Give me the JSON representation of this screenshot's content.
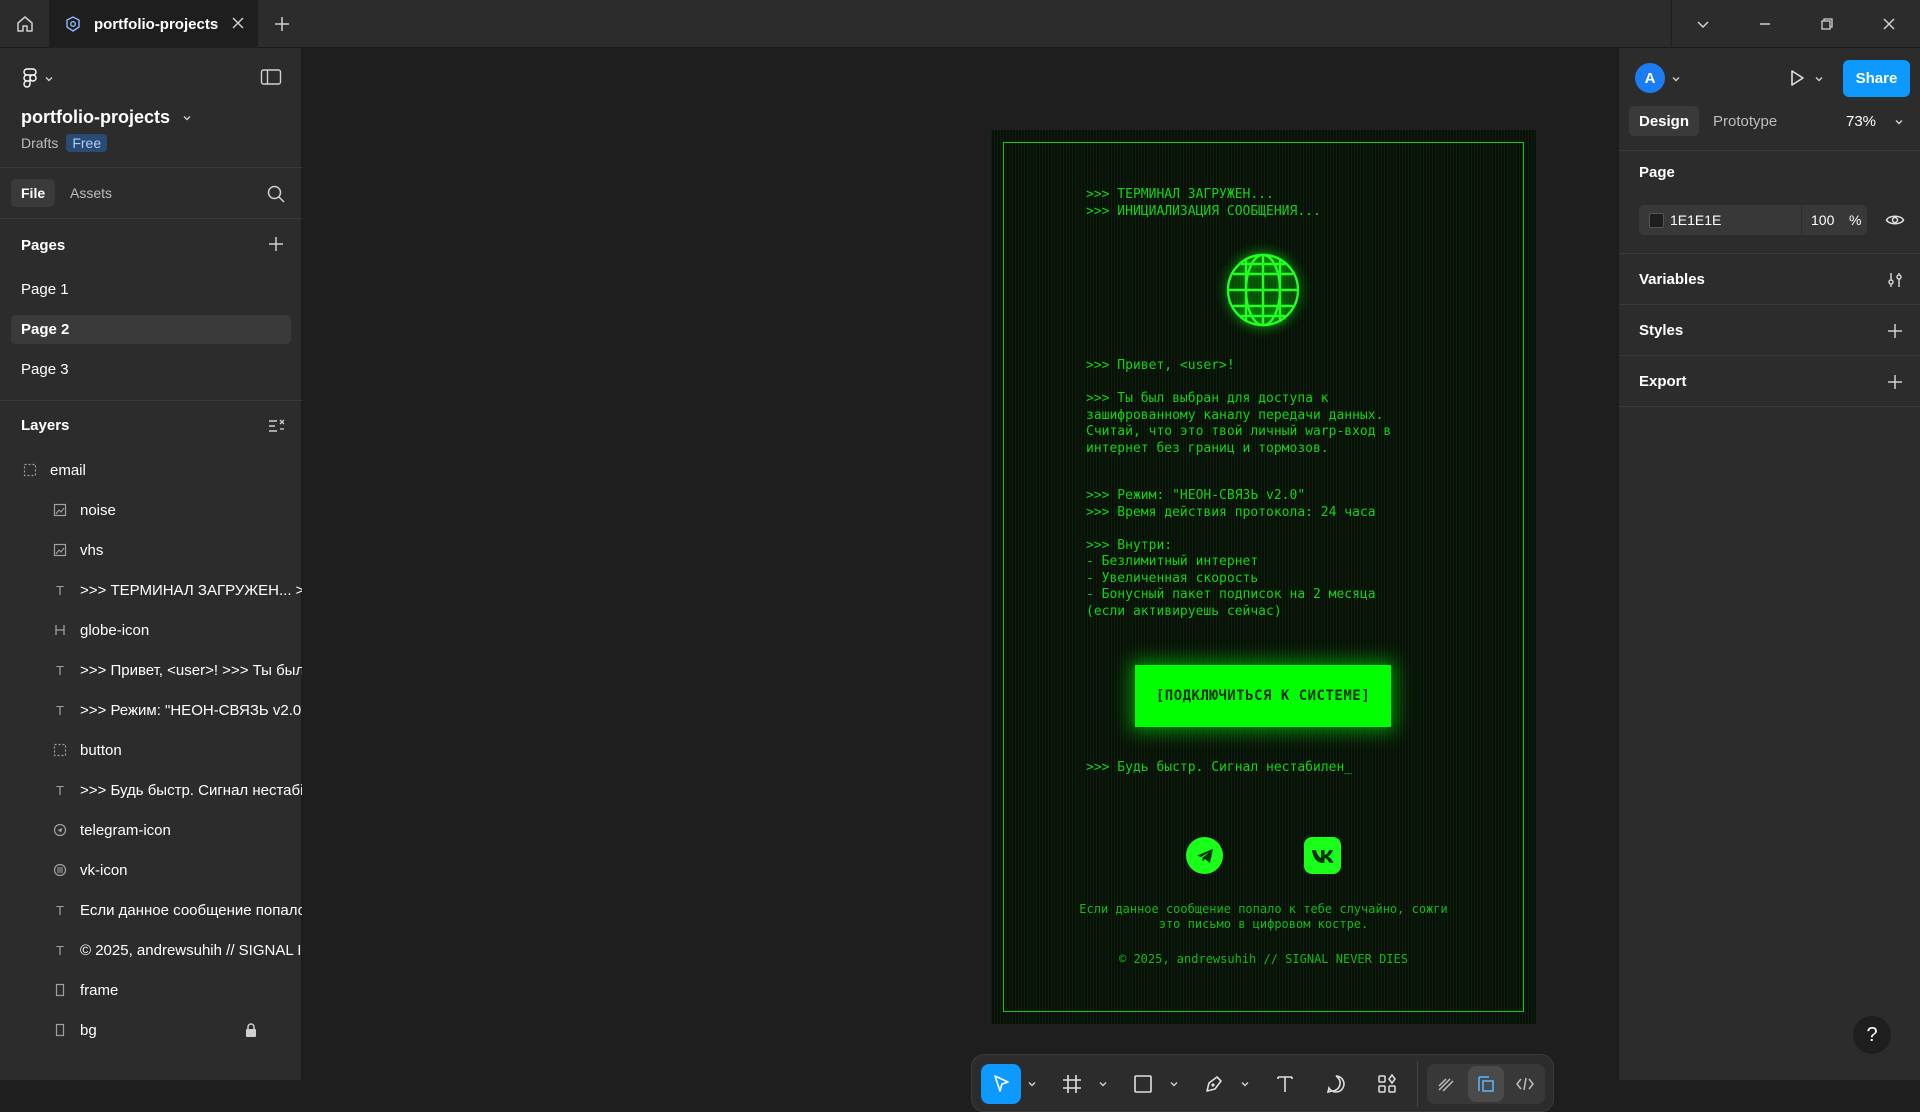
{
  "titlebar": {
    "tab_label": "portfolio-projects"
  },
  "file": {
    "project_name": "portfolio-projects",
    "location": "Drafts",
    "plan_badge": "Free"
  },
  "left_tabs": {
    "file": "File",
    "assets": "Assets"
  },
  "pages": {
    "header": "Pages",
    "items": [
      {
        "label": "Page 1",
        "active": false
      },
      {
        "label": "Page 2",
        "active": true
      },
      {
        "label": "Page 3",
        "active": false
      }
    ]
  },
  "layers": {
    "header": "Layers",
    "items": [
      {
        "label": "email",
        "icon": "frame-dashed-icon",
        "level": "root"
      },
      {
        "label": "noise",
        "icon": "image-icon",
        "level": "child"
      },
      {
        "label": "vhs",
        "icon": "image-icon",
        "level": "child"
      },
      {
        "label": ">>> ТЕРМИНАЛ ЗАГРУЖЕН... >>",
        "icon": "text-icon",
        "level": "child"
      },
      {
        "label": "globe-icon",
        "icon": "vector-icon",
        "level": "child"
      },
      {
        "label": ">>> Привет, <user>! >>> Ты был",
        "icon": "text-icon",
        "level": "child"
      },
      {
        "label": ">>> Режим: \"НЕОН-СВЯЗЬ v2.0\"",
        "icon": "text-icon",
        "level": "child"
      },
      {
        "label": "button",
        "icon": "frame-dashed-icon",
        "level": "child"
      },
      {
        "label": ">>> Будь быстр. Сигнал нестабі",
        "icon": "text-icon",
        "level": "child"
      },
      {
        "label": "telegram-icon",
        "icon": "component-icon",
        "level": "child"
      },
      {
        "label": "vk-icon",
        "icon": "component-icon",
        "level": "child"
      },
      {
        "label": "Если данное сообщение попало",
        "icon": "text-icon",
        "level": "child"
      },
      {
        "label": "© 2025, andrewsuhih // SIGNAL I",
        "icon": "text-icon",
        "level": "child"
      },
      {
        "label": "frame",
        "icon": "rectangle-icon",
        "level": "child"
      },
      {
        "label": "bg",
        "icon": "rectangle-icon",
        "level": "child",
        "locked": true
      }
    ]
  },
  "email": {
    "boot_text": ">>> ТЕРМИНАЛ ЗАГРУЖЕН...\n>>> ИНИЦИАЛИЗАЦИЯ СООБЩЕНИЯ...",
    "greeting_text": ">>> Привет, <user>!\n\n>>> Ты был выбран для доступа к\nзашифрованному каналу передачи данных.\nСчитай, что это твой личный warp-вход в\nинтернет без границ и тормозов.",
    "mode_text": ">>> Режим: \"НЕОН-СВЯЗЬ v2.0\"\n>>> Время действия протокола: 24 часа\n\n>>> Внутри:\n- Безлимитный интернет\n- Увеличенная скорость\n- Бонусный пакет подписок на 2 месяца\n(если активируешь сейчас)",
    "cta_label": "[ПОДКЛЮЧИТЬСЯ К СИСТЕМЕ]",
    "hurry_text": ">>> Будь быстр. Сигнал нестабилен_",
    "disclaimer": "Если данное сообщение попало к тебе случайно, сожги\nэто письмо в цифровом костре.",
    "copyright": "© 2025, andrewsuhih // SIGNAL NEVER DIES"
  },
  "right_panel": {
    "avatar_initial": "A",
    "share_label": "Share",
    "tab_design": "Design",
    "tab_prototype": "Prototype",
    "zoom": "73%",
    "page_section": "Page",
    "page_color_hex": "1E1E1E",
    "page_opacity": "100",
    "opacity_unit": "%",
    "variables": "Variables",
    "styles": "Styles",
    "export": "Export",
    "help": "?"
  },
  "colors": {
    "accent": "#0d99ff",
    "neon_green": "#00ff00",
    "canvas_bg": "#1e1e1e"
  }
}
